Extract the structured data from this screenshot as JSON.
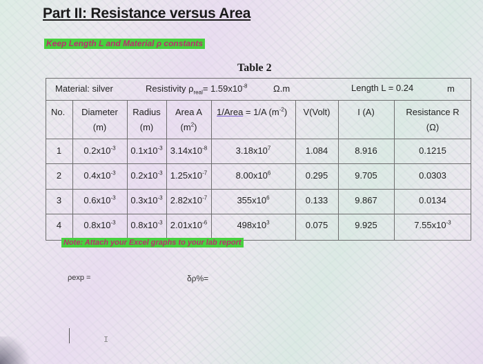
{
  "heading": "Part II: Resistance versus Area",
  "instruction": "Keep Length L and Material ρ constants",
  "table_caption": "Table 2",
  "meta": {
    "material": "Material: silver",
    "resistivity_label": "Resistivity ρ",
    "resistivity_sub": "real",
    "resistivity_value": "= 1.59x10",
    "resistivity_exp": "-8",
    "resistivity_unit": "Ω.m",
    "length_label": "Length L = 0.24",
    "length_unit": "m"
  },
  "headers": {
    "no": "No.",
    "diameter": "Diameter",
    "diameter_unit": "(m)",
    "radius": "Radius",
    "radius_unit": "(m)",
    "area": "Area A",
    "area_unit": "(m",
    "area_unit_exp": "2",
    "area_unit_close": ")",
    "inv_area_a": "1/Area",
    "inv_area_b": " = 1/A (m",
    "inv_area_exp": "-2",
    "inv_area_close": ")",
    "voltage": "V(Volt)",
    "current": "I (A)",
    "resistance": "Resistance R",
    "resistance_unit": "(Ω)"
  },
  "rows": [
    {
      "no": "1",
      "d": "0.2x10",
      "d_e": "-3",
      "r": "0.1x10",
      "r_e": "-3",
      "a": "3.14x10",
      "a_e": "-8",
      "inv": "3.18x10",
      "inv_e": "7",
      "v": "1.084",
      "i": "8.916",
      "res": "0.1215",
      "res_e": ""
    },
    {
      "no": "2",
      "d": "0.4x10",
      "d_e": "-3",
      "r": "0.2x10",
      "r_e": "-3",
      "a": "1.25x10",
      "a_e": "-7",
      "inv": "8.00x10",
      "inv_e": "6",
      "v": "0.295",
      "i": "9.705",
      "res": "0.0303",
      "res_e": ""
    },
    {
      "no": "3",
      "d": "0.6x10",
      "d_e": "-3",
      "r": "0.3x10",
      "r_e": "-3",
      "a": "2.82x10",
      "a_e": "-7",
      "inv": "355x10",
      "inv_e": "6",
      "v": "0.133",
      "i": "9.867",
      "res": "0.0134",
      "res_e": ""
    },
    {
      "no": "4",
      "d": "0.8x10",
      "d_e": "-3",
      "r": "0.8x10",
      "r_e": "-3",
      "a": "2.01x10",
      "a_e": "-6",
      "inv": "498x10",
      "inv_e": "3",
      "v": "0.075",
      "i": "9.925",
      "res": "7.55x10",
      "res_e": "-3"
    }
  ],
  "note": "Note: Attach your Excel graphs to your lab report",
  "pexp_label": "ρexp =",
  "delta_label": "δρ%="
}
